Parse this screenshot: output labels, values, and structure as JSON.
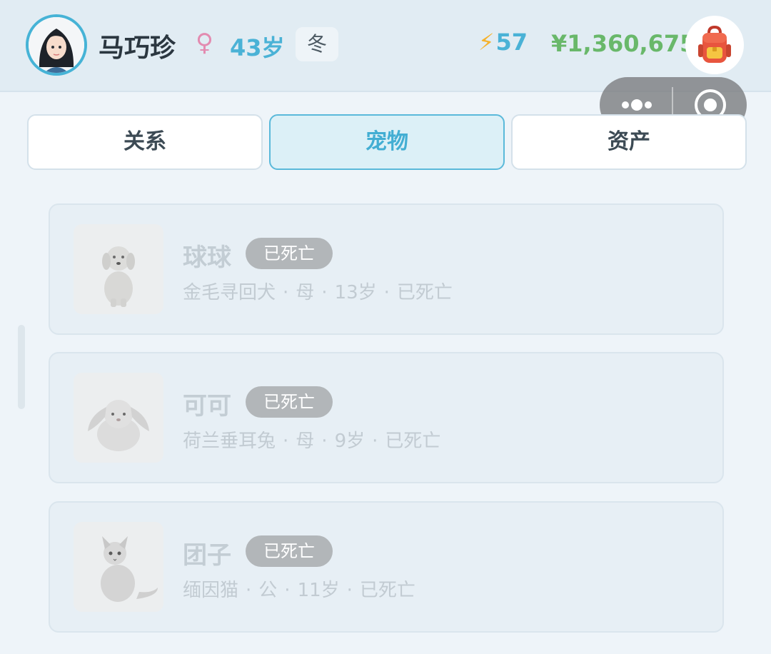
{
  "profile": {
    "name": "马巧珍",
    "gender_symbol": "♀",
    "age": "43岁",
    "season": "冬",
    "energy": "57",
    "money": "¥1,360,675"
  },
  "icons": {
    "avatar": "woman-avatar-icon",
    "energy": "lightning-icon",
    "inventory": "backpack-icon",
    "capsule_more": "more-dots-icon",
    "capsule_close": "target-close-icon"
  },
  "tabs": [
    {
      "label": "关系",
      "active": false
    },
    {
      "label": "宠物",
      "active": true
    },
    {
      "label": "资产",
      "active": false
    }
  ],
  "pets": [
    {
      "name": "球球",
      "badge": "已死亡",
      "breed": "金毛寻回犬",
      "sex": "母",
      "age": "13岁",
      "status": "已死亡",
      "image": "golden-retriever-image"
    },
    {
      "name": "可可",
      "badge": "已死亡",
      "breed": "荷兰垂耳兔",
      "sex": "母",
      "age": "9岁",
      "status": "已死亡",
      "image": "lop-rabbit-image"
    },
    {
      "name": "团子",
      "badge": "已死亡",
      "breed": "缅因猫",
      "sex": "公",
      "age": "11岁",
      "status": "已死亡",
      "image": "maine-coon-image"
    }
  ],
  "colors": {
    "accent": "#4ab2d6",
    "money": "#69b86a",
    "badge": "#b2b6b9"
  }
}
